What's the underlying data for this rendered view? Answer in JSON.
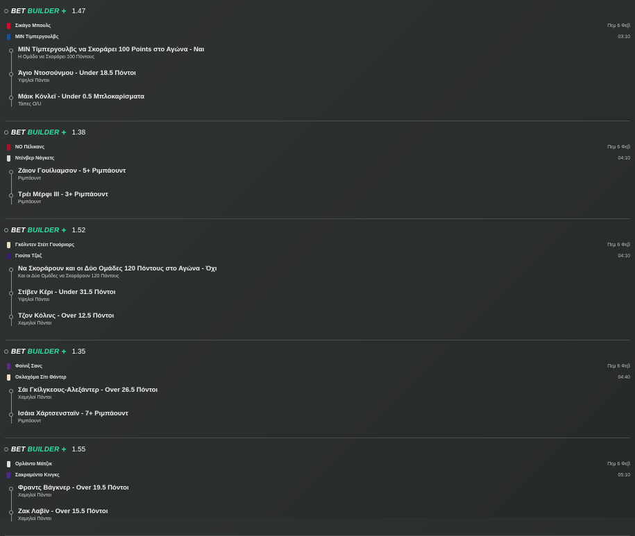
{
  "colors": {
    "accent": "#2fe0a6",
    "background": "#2e3132"
  },
  "brand": {
    "bet": "BET",
    "builder": "BUILDER",
    "plus": "+"
  },
  "bets": [
    {
      "odds": "1.47",
      "teams": [
        {
          "name": "Σικάγο Μπουλς",
          "meta": "Πεμ 6 Φεβ",
          "jersey_color": "#c8102e",
          "jersey_icon": "jersey-icon"
        },
        {
          "name": "ΜΙΝ Τίμπεργουλβς",
          "meta": "03:10",
          "jersey_color": "#1d4f91",
          "jersey_icon": "jersey-icon"
        }
      ],
      "legs": [
        {
          "title": "ΜΙΝ Τίμπεργουλβς να Σκοράρει 100 Points στο Αγώνα - Ναι",
          "sub": "Η Ομάδα να Σκοράρει 100 Πόντους"
        },
        {
          "title": "Άγιο Ντοσούνμου - Under 18.5 Πόντοι",
          "sub": "Υψηλοί Πόντοι"
        },
        {
          "title": "Μάικ Κόνλεϊ - Under 0.5 Μπλοκαρίσματα",
          "sub": "Τάπες O/U"
        }
      ]
    },
    {
      "odds": "1.38",
      "teams": [
        {
          "name": "ΝΟ Πέλικανς",
          "meta": "Πεμ 6 Φεβ",
          "jersey_color": "#a0162b",
          "jersey_icon": "jersey-icon"
        },
        {
          "name": "Ντένβερ Νάγκετς",
          "meta": "04:10",
          "jersey_color": "#d9d9d9",
          "jersey_icon": "jersey-icon"
        }
      ],
      "legs": [
        {
          "title": "Ζάιον Γουίλιαμσον - 5+ Ριμπάουντ",
          "sub": "Ριμπάουντ"
        },
        {
          "title": "Τρέι Μέρφι ΙΙΙ - 3+ Ριμπάουντ",
          "sub": "Ριμπάουντ"
        }
      ]
    },
    {
      "odds": "1.52",
      "teams": [
        {
          "name": "Γκόλντεν Στέιτ Γουόριορς",
          "meta": "Πεμ 6 Φεβ",
          "jersey_color": "#e8e0c8",
          "jersey_icon": "jersey-icon"
        },
        {
          "name": "Γιούτα Τζαζ",
          "meta": "04:10",
          "jersey_color": "#3a1f6e",
          "jersey_icon": "jersey-icon"
        }
      ],
      "legs": [
        {
          "title": "Να Σκοράρουν και οι Δύο Ομάδες 120 Πόντους στο Αγώνα - Όχι",
          "sub": "Και οι Δύο Ομάδες να Σκοράρουν 120 Πόντους"
        },
        {
          "title": "Στίβεν Κέρι - Under 31.5 Πόντοι",
          "sub": "Υψηλοί Πόντοι"
        },
        {
          "title": "Τζον Κόλινς - Over 12.5 Πόντοι",
          "sub": "Χαμηλοί Πόντοι"
        }
      ]
    },
    {
      "odds": "1.35",
      "teams": [
        {
          "name": "Φοίνιξ Σανς",
          "meta": "Πεμ 6 Φεβ",
          "jersey_color": "#5a2d82",
          "jersey_icon": "jersey-icon"
        },
        {
          "name": "Οκλαχόμα Σίτι Θάντερ",
          "meta": "04:40",
          "jersey_color": "#e8e0c8",
          "jersey_icon": "jersey-icon"
        }
      ],
      "legs": [
        {
          "title": "Σάι Γκίλγκεους-Αλεξάντερ - Over 26.5 Πόντοι",
          "sub": "Χαμηλοί Πόντοι"
        },
        {
          "title": "Ισάια Χάρτσενσταϊν - 7+ Ριμπάουντ",
          "sub": "Ριμπάουντ"
        }
      ]
    },
    {
      "odds": "1.55",
      "teams": [
        {
          "name": "Ορλάντο Μάτζικ",
          "meta": "Πεμ 6 Φεβ",
          "jersey_color": "#e0e0e0",
          "jersey_icon": "jersey-icon"
        },
        {
          "name": "Σακραμέντο Κινγκς",
          "meta": "05:10",
          "jersey_color": "#4b2a8a",
          "jersey_icon": "jersey-icon"
        }
      ],
      "legs": [
        {
          "title": "Φραντς Βάγκνερ - Over 19.5 Πόντοι",
          "sub": "Χαμηλοί Πόντοι"
        },
        {
          "title": "Ζακ Λαβίν - Over 15.5 Πόντοι",
          "sub": "Χαμηλοί Πόντοι"
        }
      ]
    }
  ]
}
